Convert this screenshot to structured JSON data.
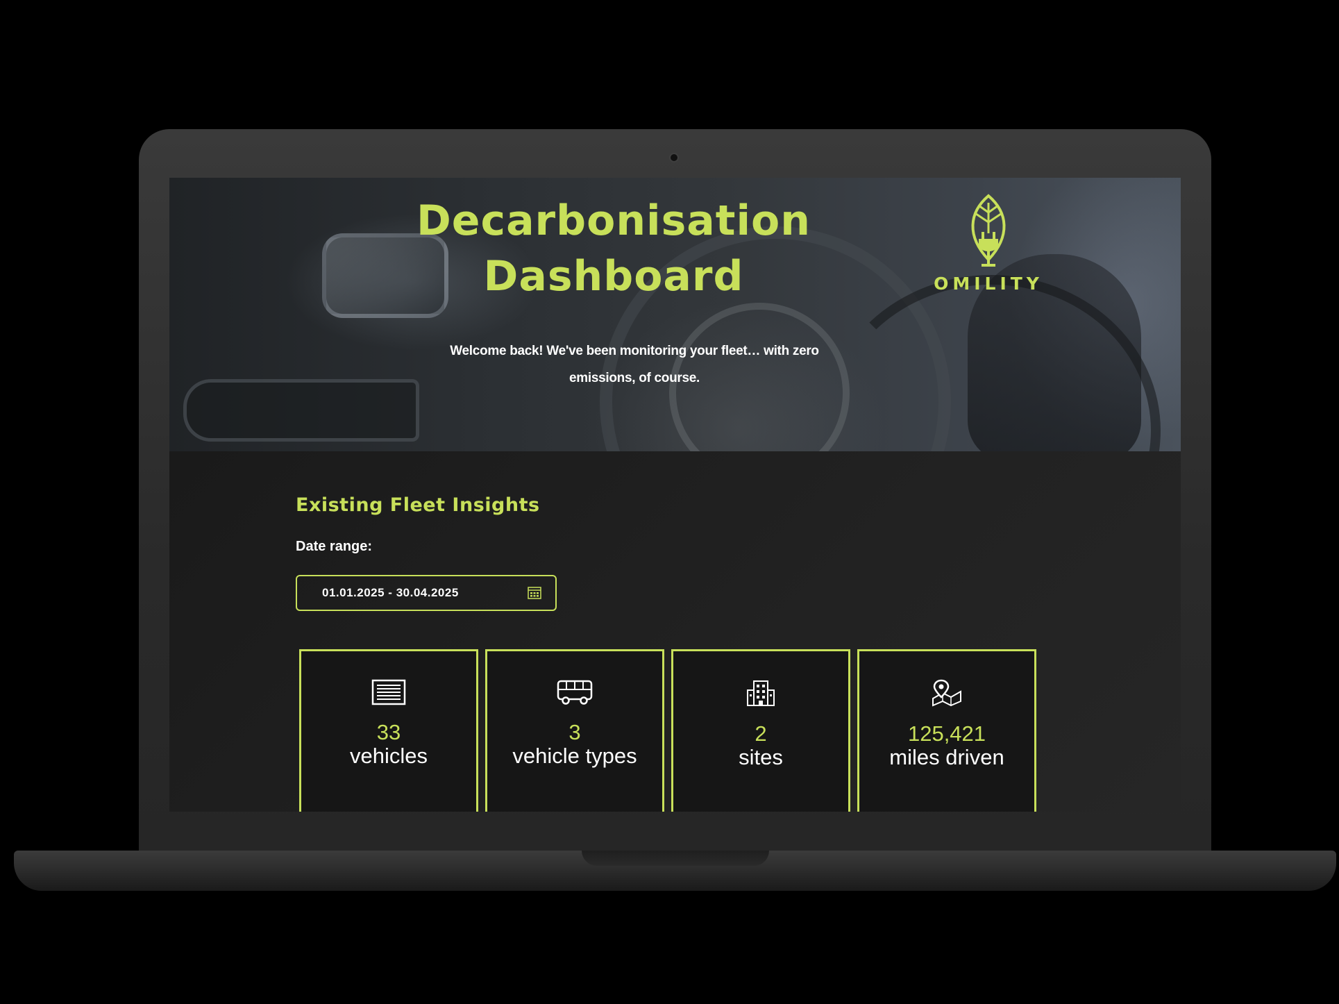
{
  "header": {
    "title_line1": "Decarbonisation",
    "title_line2": "Dashboard",
    "welcome_line1": "Welcome back! We've been monitoring your fleet… with zero",
    "welcome_line2": "emissions, of course.",
    "logo_text": "OMILITY"
  },
  "insights": {
    "section_title": "Existing Fleet Insights",
    "date_label": "Date range:",
    "date_value": "01.01.2025 - 30.04.2025",
    "cards": [
      {
        "value": "33",
        "label": "vehicles",
        "icon": "vehicle-grille-icon"
      },
      {
        "value": "3",
        "label": "vehicle types",
        "icon": "bus-icon"
      },
      {
        "value": "2",
        "label": "sites",
        "icon": "building-icon"
      },
      {
        "value": "125,421",
        "label": "miles driven",
        "icon": "map-pin-icon"
      }
    ]
  },
  "colors": {
    "accent": "#c8e05a",
    "background": "#1e1e1e",
    "card_background": "#161616",
    "text": "#ffffff"
  }
}
